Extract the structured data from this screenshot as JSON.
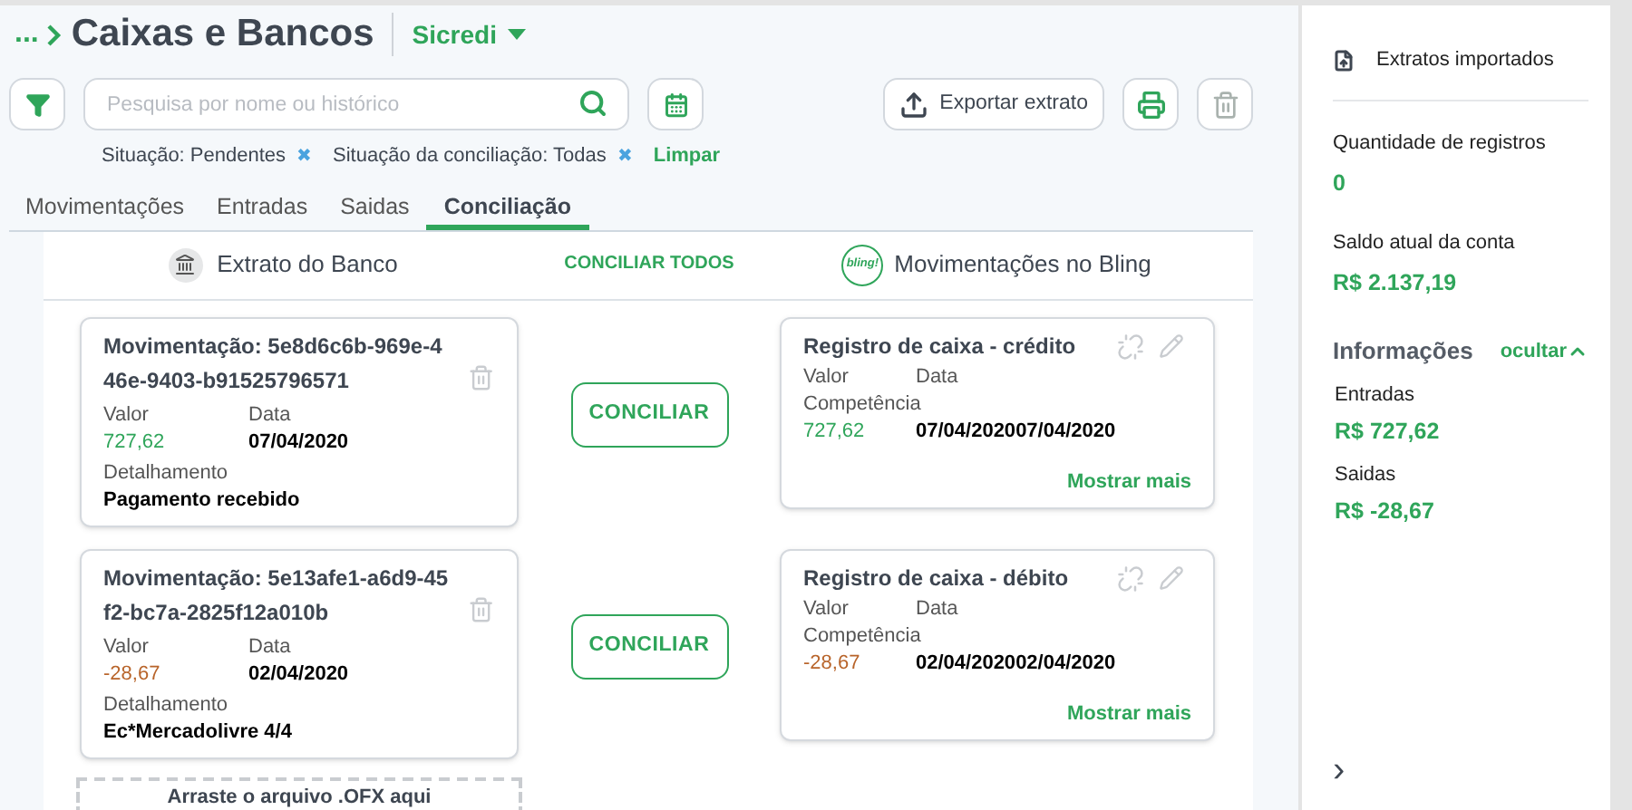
{
  "breadcrumb": {
    "ellipsis": "...",
    "title": "Caixas e Bancos",
    "account": "Sicredi"
  },
  "search": {
    "placeholder": "Pesquisa por nome ou histórico"
  },
  "export_button": "Exportar extrato",
  "filters": [
    {
      "label": "Situação: Pendentes",
      "remove": "✖"
    },
    {
      "label": "Situação da conciliação: Todas",
      "remove": "✖"
    }
  ],
  "clear_filters": "Limpar",
  "tabs": [
    {
      "label": "Movimentações",
      "selected": false
    },
    {
      "label": "Entradas",
      "selected": false
    },
    {
      "label": "Saidas",
      "selected": false
    },
    {
      "label": "Conciliação",
      "selected": true
    }
  ],
  "columns": {
    "bank": "Extrato do Banco",
    "reconcile_all": "CONCILIAR TODOS",
    "bling": "Movimentações no Bling",
    "bling_logo": "bling!"
  },
  "rows": [
    {
      "kind": "credit",
      "bank": {
        "title": "Movimentação: 5e8d6c6b-969e-446e-9403-b91525796571",
        "value_label": "Valor",
        "value": "727,62",
        "date_label": "Data",
        "date": "07/04/2020",
        "detail_label": "Detalhamento",
        "detail": "Pagamento recebido"
      },
      "button": "CONCILIAR",
      "bling": {
        "title": "Registro de caixa - crédito",
        "value_label": "Valor",
        "date_label": "Data",
        "competence_label": "Competência",
        "value": "727,62",
        "date": "07/04/2020",
        "competence": "07/04/2020",
        "more": "Mostrar mais"
      }
    },
    {
      "kind": "debit",
      "bank": {
        "title": "Movimentação: 5e13afe1-a6d9-45f2-bc7a-2825f12a010b",
        "value_label": "Valor",
        "value": "-28,67",
        "date_label": "Data",
        "date": "02/04/2020",
        "detail_label": "Detalhamento",
        "detail": "Ec*Mercadolivre 4/4"
      },
      "button": "CONCILIAR",
      "bling": {
        "title": "Registro de caixa - débito",
        "value_label": "Valor",
        "date_label": "Data",
        "competence_label": "Competência",
        "value": "-28,67",
        "date": "02/04/2020",
        "competence": "02/04/2020",
        "more": "Mostrar mais"
      }
    }
  ],
  "dropzone": "Arraste o arquivo .OFX aqui",
  "sidebar": {
    "imported": "Extratos importados",
    "stats": [
      {
        "label": "Quantidade de registros",
        "value": "0"
      },
      {
        "label": "Saldo atual da conta",
        "value": "R$ 2.137,19"
      }
    ],
    "info_title": "Informações",
    "hide": "ocultar",
    "info": [
      {
        "label": "Entradas",
        "value": "R$ 727,62"
      },
      {
        "label": "Saidas",
        "value": "R$ -28,67"
      }
    ],
    "expand": "›"
  }
}
